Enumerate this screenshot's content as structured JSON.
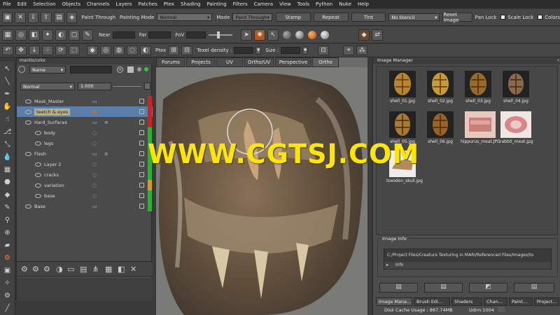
{
  "menu": [
    "File",
    "Edit",
    "Selection",
    "Objects",
    "Channels",
    "Layers",
    "Patches",
    "Ptex",
    "Shading",
    "Painting",
    "Filters",
    "Camera",
    "View",
    "Tools",
    "Python",
    "Nuke",
    "Help"
  ],
  "toolbar1": {
    "paint_through_label": "Paint Through",
    "painting_mode_label": "Painting Mode",
    "painting_mode_value": "Normal",
    "mode_label": "Mode",
    "mode_value": "Paint Through",
    "stamp": "Stamp",
    "repeat": "Repeat",
    "tint": "Tint",
    "stencil_value": "No Stencil",
    "reset_image": "Reset Image",
    "pan_lock": "Pan Lock",
    "scale_lock": "Scale Lock",
    "colors": "Colors"
  },
  "toolbar2": {
    "near_label": "Near",
    "far_label": "Far",
    "fov_label": "FoV"
  },
  "toolbar3": {
    "ptex_label": "Ptex",
    "texel_density_label": "Texel density :",
    "size_label": "Size :"
  },
  "layers": {
    "path": "mantis/color",
    "filter_value": "Name",
    "blend_mode": "Normal",
    "opacity": "1.000",
    "rows": [
      {
        "label": "Mask_Master",
        "indent": 0,
        "bar": "#d22020"
      },
      {
        "label": "teetch & eyes",
        "indent": 0,
        "bar": "#d22020",
        "selected": true
      },
      {
        "label": "Hard_Surfaces",
        "indent": 0,
        "bar": "#d22020"
      },
      {
        "label": "body",
        "indent": 1,
        "bar": "#27b52a"
      },
      {
        "label": "legs",
        "indent": 1,
        "bar": "#27b52a"
      },
      {
        "label": "Flesh",
        "indent": 0,
        "bar": "#27b52a"
      },
      {
        "label": "Layer 2",
        "indent": 1,
        "bar": "#27b52a"
      },
      {
        "label": "cracks",
        "indent": 1,
        "bar": "#27b52a"
      },
      {
        "label": "variation",
        "indent": 1,
        "bar": "#d79a1a"
      },
      {
        "label": "base",
        "indent": 1,
        "bar": "#27b52a"
      },
      {
        "label": "Base",
        "indent": 0,
        "bar": "#27b52a"
      }
    ]
  },
  "viewport_tabs": [
    "Forums",
    "Projects",
    "UV",
    "Ortho/UV",
    "Perspective",
    "Ortho"
  ],
  "image_manager": {
    "title": "Image Manager",
    "images": [
      {
        "name": "shell_01.jpg"
      },
      {
        "name": "shell_02.jpg"
      },
      {
        "name": "shell_03.jpg"
      },
      {
        "name": "shell_04.jpg"
      },
      {
        "name": "shell_05.jpg"
      },
      {
        "name": "shell_06.jpg"
      },
      {
        "name": "hippurus_meat.JPG"
      },
      {
        "name": "rabbit_meat.jpg"
      },
      {
        "name": "toxodon_skull.jpg"
      }
    ],
    "info_title": "Image Info",
    "info_path": "C:/Project Files/Creature Texturing in MARI/Referenced Files/Images/to",
    "info_label": "Info"
  },
  "bottom_tabs": [
    "Image Mana...",
    "Brush Edi...",
    "Shaders",
    "Chan...",
    "Paint...",
    "Project..."
  ],
  "status": {
    "disk_cache": "Disk Cache Usage : 867.74MB",
    "udim": "Udim:1004"
  },
  "watermark": "WWW.CGTSJ.COM"
}
